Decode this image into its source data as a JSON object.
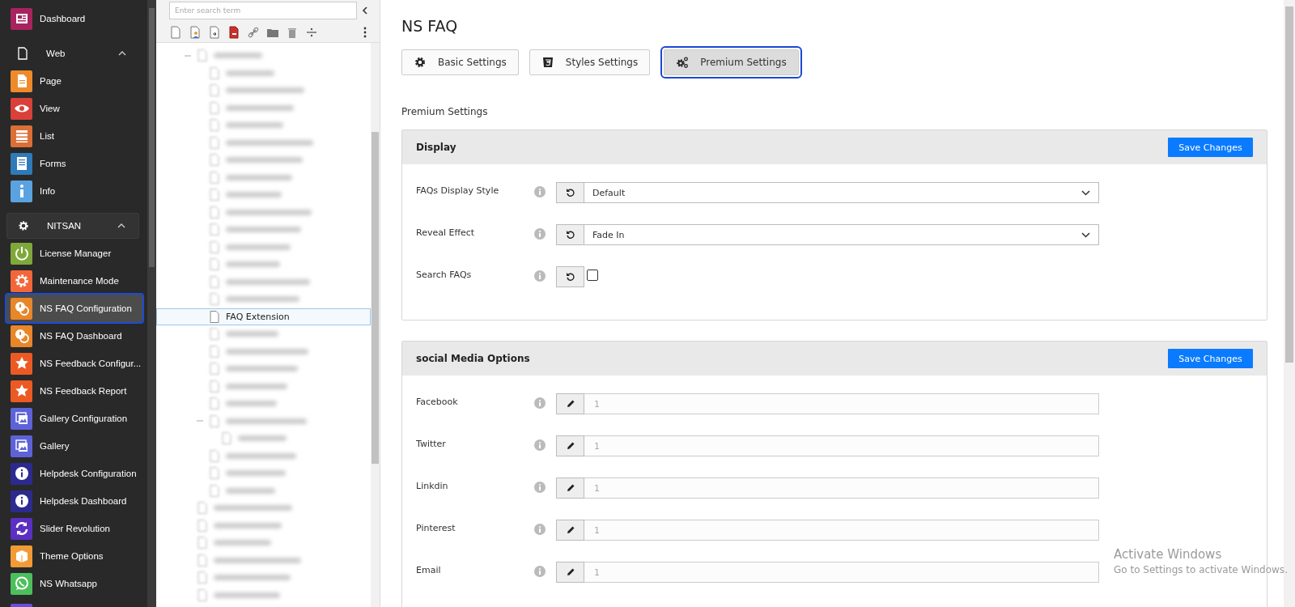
{
  "sidebar": {
    "items": [
      {
        "kind": "module",
        "label": "Dashboard",
        "color": "#a7245f",
        "selected": false
      },
      {
        "kind": "group",
        "label": "Web",
        "expanded": true,
        "active": false
      },
      {
        "kind": "module",
        "label": "Page",
        "color": "#ef8a2b",
        "selected": false
      },
      {
        "kind": "module",
        "label": "View",
        "color": "#d9403a",
        "selected": false
      },
      {
        "kind": "module",
        "label": "List",
        "color": "#db6f36",
        "selected": false
      },
      {
        "kind": "module",
        "label": "Forms",
        "color": "#2f7ab8",
        "selected": false
      },
      {
        "kind": "module",
        "label": "Info",
        "color": "#5aa2e0",
        "selected": false
      },
      {
        "kind": "group",
        "label": "NITSAN",
        "expanded": true,
        "active": true
      },
      {
        "kind": "module",
        "label": "License Manager",
        "color": "#7ea93a",
        "selected": false
      },
      {
        "kind": "module",
        "label": "Maintenance Mode",
        "color": "#f2673a",
        "selected": false
      },
      {
        "kind": "module",
        "label": "NS FAQ Configuration",
        "color": "#e8862a",
        "selected": true
      },
      {
        "kind": "module",
        "label": "NS FAQ Dashboard",
        "color": "#e8862a",
        "selected": false
      },
      {
        "kind": "module",
        "label": "NS Feedback Configur...",
        "color": "#ec5a24",
        "selected": false
      },
      {
        "kind": "module",
        "label": "NS Feedback Report",
        "color": "#ec5a24",
        "selected": false
      },
      {
        "kind": "module",
        "label": "Gallery Configuration",
        "color": "#5d62d8",
        "selected": false
      },
      {
        "kind": "module",
        "label": "Gallery",
        "color": "#5d62d8",
        "selected": false
      },
      {
        "kind": "module",
        "label": "Helpdesk Configuration",
        "color": "#2c2a8f",
        "selected": false
      },
      {
        "kind": "module",
        "label": "Helpdesk Dashboard",
        "color": "#2c2a8f",
        "selected": false
      },
      {
        "kind": "module",
        "label": "Slider Revolution",
        "color": "#5b2fc2",
        "selected": false
      },
      {
        "kind": "module",
        "label": "Theme Options",
        "color": "#f29a35",
        "selected": false
      },
      {
        "kind": "module",
        "label": "NS Whatsapp",
        "color": "#4cbf5c",
        "selected": false
      },
      {
        "kind": "module",
        "color": "#6a4fd6",
        "selected": false
      }
    ]
  },
  "tree": {
    "search": {
      "placeholder": "Enter search term"
    },
    "items": [
      {
        "blurred": true,
        "selected": false,
        "expanded": true,
        "children": [
          {
            "blurred": true,
            "selected": false
          },
          {
            "blurred": true,
            "selected": false
          },
          {
            "blurred": true,
            "selected": false
          },
          {
            "blurred": true,
            "selected": false
          },
          {
            "blurred": true,
            "selected": false
          },
          {
            "blurred": true,
            "selected": false
          },
          {
            "blurred": true,
            "selected": false
          },
          {
            "blurred": true,
            "selected": false
          },
          {
            "blurred": true,
            "selected": false
          },
          {
            "blurred": true,
            "selected": false
          },
          {
            "blurred": true,
            "selected": false
          },
          {
            "blurred": true,
            "selected": false
          },
          {
            "blurred": true,
            "selected": false
          },
          {
            "blurred": true,
            "selected": false
          },
          {
            "blurred": false,
            "label": "FAQ Extension",
            "selected": true
          },
          {
            "blurred": true,
            "selected": false
          },
          {
            "blurred": true,
            "selected": false
          },
          {
            "blurred": true,
            "selected": false
          },
          {
            "blurred": true,
            "selected": false
          },
          {
            "blurred": true,
            "selected": false
          },
          {
            "blurred": true,
            "selected": false,
            "expanded": true,
            "children": [
              {
                "blurred": true,
                "selected": false
              }
            ]
          },
          {
            "blurred": true,
            "selected": false
          },
          {
            "blurred": true,
            "selected": false
          },
          {
            "blurred": true,
            "selected": false
          }
        ]
      },
      {
        "blurred": true,
        "selected": false
      },
      {
        "blurred": true,
        "selected": false
      },
      {
        "blurred": true,
        "selected": false
      },
      {
        "blurred": true,
        "selected": false
      },
      {
        "blurred": true,
        "selected": false
      },
      {
        "blurred": true,
        "selected": false
      }
    ]
  },
  "page": {
    "title": "NS FAQ",
    "tabs": [
      {
        "label": "Basic Settings",
        "selected": false
      },
      {
        "label": "Styles Settings",
        "selected": false
      },
      {
        "label": "Premium Settings",
        "selected": true
      }
    ],
    "subtitle": "Premium Settings",
    "panels": [
      {
        "title": "Display",
        "button": "Save Changes",
        "fields": [
          {
            "label": "FAQs Display Style",
            "kind": "select",
            "value": "Default"
          },
          {
            "label": "Reveal Effect",
            "kind": "select",
            "value": "Fade In"
          },
          {
            "label": "Search FAQs",
            "kind": "checkbox",
            "checked": false
          }
        ]
      },
      {
        "title": "social Media Options",
        "button": "Save Changes",
        "fields": [
          {
            "label": "Facebook",
            "kind": "text",
            "placeholder": "1"
          },
          {
            "label": "Twitter",
            "kind": "text",
            "placeholder": "1"
          },
          {
            "label": "Linkdin",
            "kind": "text",
            "placeholder": "1"
          },
          {
            "label": "Pinterest",
            "kind": "text",
            "placeholder": "1"
          },
          {
            "label": "Email",
            "kind": "text",
            "placeholder": "1"
          }
        ]
      }
    ]
  },
  "os_notice": {
    "title": "Activate Windows",
    "text": "Go to Settings to activate Windows."
  }
}
